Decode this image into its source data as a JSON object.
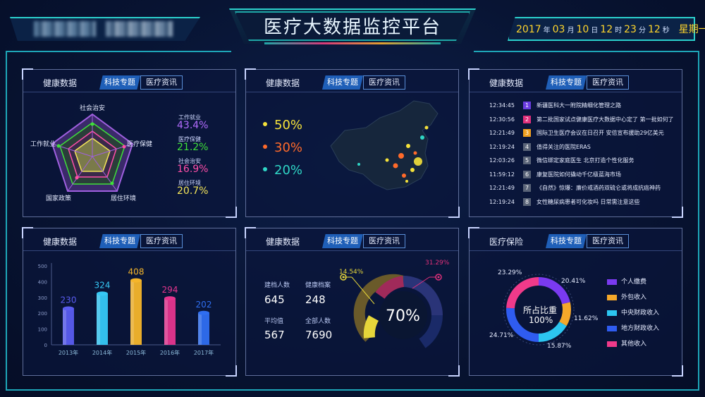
{
  "header": {
    "title": "医疗大数据监控平台",
    "date": {
      "year": "2017",
      "year_u": "年",
      "month": "03",
      "month_u": "月",
      "day": "10",
      "day_u": "日",
      "hour": "12",
      "hour_u": "时",
      "minute": "23",
      "minute_u": "分",
      "second": "12",
      "second_u": "秒",
      "weekday": "星期一"
    }
  },
  "tabs": {
    "tech": "科技专题",
    "med": "医疗资讯"
  },
  "panels": {
    "radar": {
      "title": "健康数据",
      "axes": [
        "社会治安",
        "医疗保健",
        "居住环境",
        "国家政策",
        "工作就业"
      ],
      "legend": [
        {
          "label": "工作就业",
          "value": "43.4%",
          "color": "#b36cff"
        },
        {
          "label": "医疗保健",
          "value": "21.2%",
          "color": "#3fe03a"
        },
        {
          "label": "社会治安",
          "value": "16.9%",
          "color": "#ff4fa8"
        },
        {
          "label": "居住环境",
          "value": "20.7%",
          "color": "#f5e65a"
        }
      ]
    },
    "map": {
      "title": "健康数据",
      "items": [
        {
          "value": "50%",
          "color": "#f5e23a"
        },
        {
          "value": "30%",
          "color": "#ff6a2a"
        },
        {
          "value": "20%",
          "color": "#2fd6c6"
        }
      ]
    },
    "news": {
      "title": "健康数据",
      "items": [
        {
          "time": "12:34:45",
          "num": "1",
          "color": "#6a3ce0",
          "text": "新疆医科大一附院精细化管理之路"
        },
        {
          "time": "12:30:56",
          "num": "2",
          "color": "#e0307a",
          "text": "第二批国家试点健康医疗大数据中心定了 第一批如何了"
        },
        {
          "time": "12:21:49",
          "num": "3",
          "color": "#f0a020",
          "text": "国际卫生医疗会议在日召开 安倍宣布援助29亿美元"
        },
        {
          "time": "12:19:24",
          "num": "4",
          "color": "#5a6478",
          "text": "值得关注的医院ERAS"
        },
        {
          "time": "12:03:26",
          "num": "5",
          "color": "#5a6478",
          "text": "微信绑定家庭医生 北京打造个性化服务"
        },
        {
          "time": "11:59:12",
          "num": "6",
          "color": "#5a6478",
          "text": "康复医院如何撬动千亿级蓝海市场"
        },
        {
          "time": "12:21:49",
          "num": "7",
          "color": "#5a6478",
          "text": "《自然》惊爆：廉价戒酒药双硫仑或将成抗癌神药"
        },
        {
          "time": "12:19:24",
          "num": "8",
          "color": "#5a6478",
          "text": "女性糖尿病患者可化妆吗 日常需注意这些"
        }
      ]
    },
    "bars": {
      "title": "健康数据",
      "chart_data": {
        "type": "bar",
        "categories": [
          "2013年",
          "2014年",
          "2015年",
          "2016年",
          "2017年"
        ],
        "values": [
          230,
          324,
          408,
          294,
          202
        ],
        "ylim": [
          0,
          500
        ],
        "yticks": [
          "0",
          "100",
          "200",
          "300",
          "400",
          "500"
        ],
        "colors": [
          "#5a5cf0",
          "#36c8f5",
          "#f5b52a",
          "#e5358e",
          "#2f6ef0"
        ]
      }
    },
    "gauge": {
      "title": "健康数据",
      "stats": [
        {
          "label": "建档人数",
          "value": "645"
        },
        {
          "label": "健康档案",
          "value": "248"
        },
        {
          "label": "平均值",
          "value": "567"
        },
        {
          "label": "全部人数",
          "value": "7690"
        }
      ],
      "center": "70%",
      "callout_left": "14.54%",
      "callout_right": "31.29%"
    },
    "insurance": {
      "title": "医疗保险",
      "center_line1": "所占比重",
      "center_line2": "100%",
      "slices": [
        {
          "label": "个人缴费",
          "value": 20.41,
          "text": "20.41%",
          "color": "#7a3af0"
        },
        {
          "label": "外包收入",
          "value": 11.62,
          "text": "11.62%",
          "color": "#f5a82a"
        },
        {
          "label": "中央财政收入",
          "value": 15.87,
          "text": "15.87%",
          "color": "#2cc6f0"
        },
        {
          "label": "地方财政收入",
          "value": 24.71,
          "text": "24.71%",
          "color": "#2f5cf0"
        },
        {
          "label": "其他收入",
          "value": 23.29,
          "text": "23.29%",
          "color": "#f03a8a"
        }
      ]
    }
  }
}
